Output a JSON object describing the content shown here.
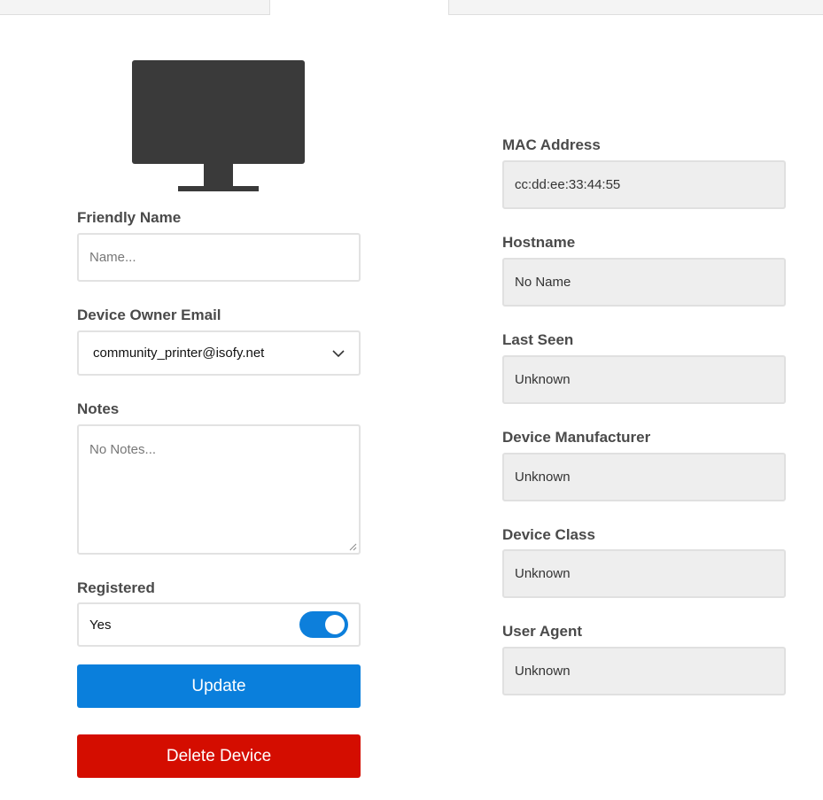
{
  "form": {
    "friendly_name": {
      "label": "Friendly Name",
      "placeholder": "Name...",
      "value": ""
    },
    "owner_email": {
      "label": "Device Owner Email",
      "value": "community_printer@isofy.net"
    },
    "notes": {
      "label": "Notes",
      "placeholder": "No Notes..."
    },
    "registered": {
      "label": "Registered",
      "value_text": "Yes",
      "checked": true
    },
    "update_label": "Update",
    "delete_label": "Delete Device"
  },
  "details": {
    "mac": {
      "label": "MAC Address",
      "value": "cc:dd:ee:33:44:55"
    },
    "hostname": {
      "label": "Hostname",
      "value": "No Name"
    },
    "last_seen": {
      "label": "Last Seen",
      "value": "Unknown"
    },
    "manufacturer": {
      "label": "Device Manufacturer",
      "value": "Unknown"
    },
    "device_class": {
      "label": "Device Class",
      "value": "Unknown"
    },
    "user_agent": {
      "label": "User Agent",
      "value": "Unknown"
    }
  },
  "icons": {
    "device": "monitor-icon",
    "dropdown": "chevron-down-icon"
  },
  "colors": {
    "primary": "#0a7fdc",
    "danger": "#d40d00",
    "toggle_on": "#0d7fdb",
    "readonly_bg": "#eeeeee",
    "monitor": "#3a3a3a"
  }
}
